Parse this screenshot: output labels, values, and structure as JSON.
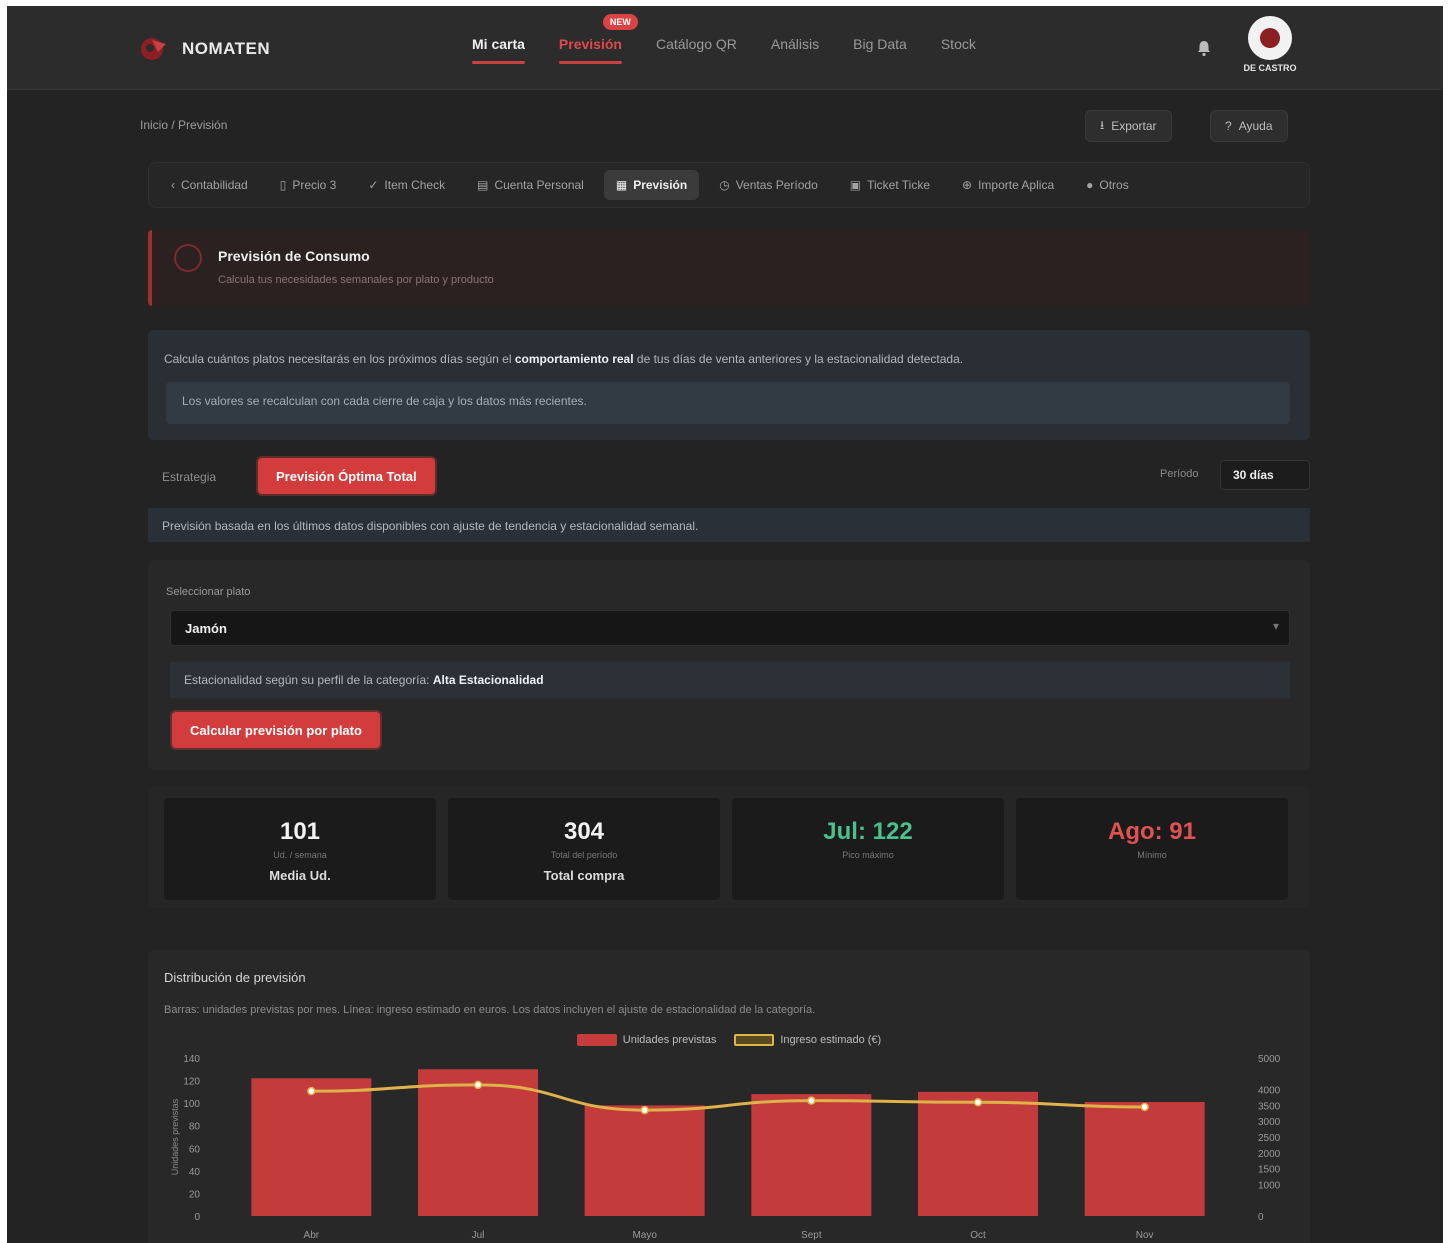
{
  "app": {
    "brand": "NOMATEN",
    "user_name": "DE CASTRO"
  },
  "nav": {
    "items": [
      "Mi carta",
      "Previsión",
      "Catálogo QR",
      "Análisis",
      "Big Data",
      "Stock"
    ],
    "badge": "NEW"
  },
  "toolbar": {
    "breadcrumb": "Inicio / Previsión",
    "export_label": "Exportar",
    "help_label": "Ayuda"
  },
  "tabs": [
    "Contabilidad",
    "Precio 3",
    "Item Check",
    "Cuenta Personal",
    "Previsión",
    "Ventas Período",
    "Ticket Ticke",
    "Importe Aplica",
    "Otros"
  ],
  "alert": {
    "title": "Previsión de Consumo",
    "subtitle": "Calcula tus necesidades semanales por plato y producto"
  },
  "info": {
    "text_a": "Calcula cuántos platos necesitarás en los próximos días según el ",
    "text_bold": "comportamiento real",
    "text_b": " de tus días de venta anteriores y la estacionalidad detectada.",
    "note": "Los valores se recalculan con cada cierre de caja y los datos más recientes."
  },
  "mode": {
    "label": "Estrategia",
    "button": "Previsión Óptima Total",
    "period_label": "Período",
    "period_value": "30 días"
  },
  "mode_desc": "Previsión basada en los últimos datos disponibles con ajuste de tendencia y estacionalidad semanal.",
  "form": {
    "field_label": "Seleccionar plato",
    "selected": "Jamón",
    "hint_a": "Estacionalidad según su perfil de la categoría: ",
    "hint_bold": "Alta Estacionalidad",
    "submit": "Calcular previsión por plato"
  },
  "stats": [
    {
      "value": "101",
      "label": "Ud. / semana",
      "sub": "Media Ud."
    },
    {
      "value": "304",
      "label": "Total del período",
      "sub": "Total compra"
    },
    {
      "value": "Jul: 122",
      "label": "Pico máximo",
      "sub": ""
    },
    {
      "value": "Ago: 91",
      "label": "Mínimo",
      "sub": ""
    }
  ],
  "chart_card": {
    "title": "Distribución de previsión",
    "subtitle": "Barras: unidades previstas por mes. Línea: ingreso estimado en euros. Los datos incluyen el ajuste de estacionalidad de la categoría."
  },
  "colors": {
    "accent": "#d23c3c",
    "bar": "#c33b3a",
    "line": "#e0b24a",
    "green": "#4bbf8c"
  },
  "chart_data": {
    "type": "bar",
    "categories": [
      "Abr",
      "Jul",
      "Mayo",
      "Sept",
      "Oct",
      "Nov"
    ],
    "series": [
      {
        "name": "Unidades previstas",
        "type": "bar",
        "axis": "left",
        "values": [
          122,
          130,
          98,
          108,
          110,
          101
        ]
      },
      {
        "name": "Ingreso estimado (€)",
        "type": "line",
        "axis": "right",
        "values": [
          3950,
          4150,
          3350,
          3650,
          3600,
          3450
        ]
      }
    ],
    "ylim": [
      0,
      140
    ],
    "yticks": [
      0,
      20,
      40,
      60,
      80,
      100,
      120,
      140
    ],
    "y2lim": [
      0,
      5000
    ],
    "y2ticks": [
      0,
      1000,
      1500,
      2000,
      2500,
      3000,
      3500,
      4000,
      5000
    ],
    "ylabel": "Unidades previstas",
    "legend": "top-center",
    "grid": false
  }
}
